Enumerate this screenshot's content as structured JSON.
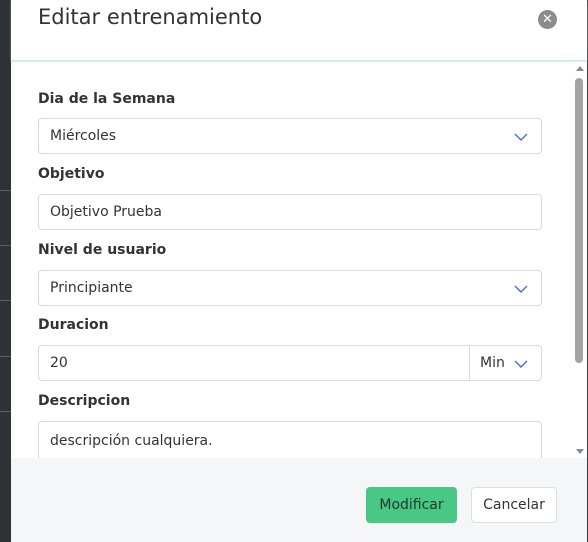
{
  "modal": {
    "title": "Editar entrenamiento",
    "close_icon": "close-icon"
  },
  "form": {
    "day": {
      "label": "Dia de la Semana",
      "selected": "Miércoles",
      "icon": "chevron-down-icon"
    },
    "objective": {
      "label": "Objetivo",
      "value": "Objetivo Prueba"
    },
    "user_level": {
      "label": "Nivel de usuario",
      "selected": "Principiante",
      "icon": "chevron-down-icon"
    },
    "duration": {
      "label": "Duracion",
      "value": "20",
      "unit": "Min",
      "icon": "chevron-down-icon"
    },
    "description": {
      "label": "Descripcion",
      "value": "descripción cualquiera."
    }
  },
  "footer": {
    "submit_label": "Modificar",
    "cancel_label": "Cancelar"
  },
  "colors": {
    "primary_button": "#48c785",
    "header_border": "#c7ecd2",
    "chevron": "#4a6bd6",
    "close_button": "#8c8c8c"
  }
}
